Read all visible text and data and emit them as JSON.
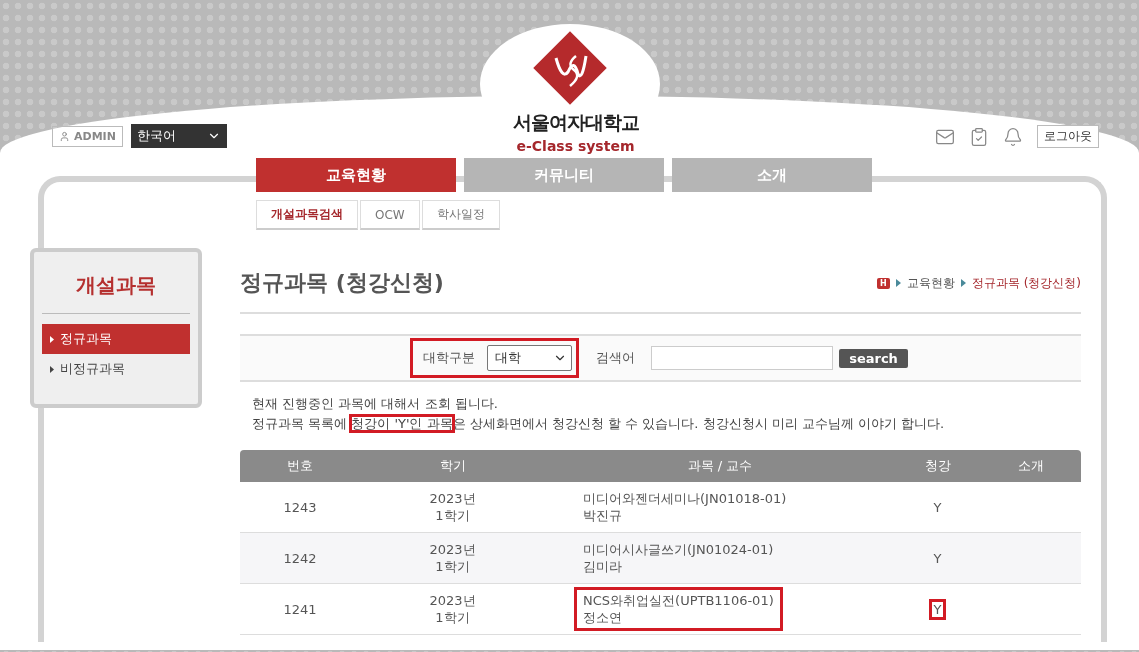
{
  "header": {
    "user": "ADMIN",
    "language": "한국어",
    "school_name": "서울여자대학교",
    "system_name": "e-Class system",
    "logout": "로그아웃"
  },
  "nav_tabs": [
    {
      "label": "교육현황",
      "selected": true
    },
    {
      "label": "커뮤니티",
      "selected": false
    },
    {
      "label": "소개",
      "selected": false
    }
  ],
  "sub_tabs": [
    {
      "label": "개설과목검색",
      "selected": true
    },
    {
      "label": "OCW",
      "selected": false
    },
    {
      "label": "학사일정",
      "selected": false
    }
  ],
  "sidebar": {
    "title": "개설과목",
    "items": [
      {
        "label": "정규과목",
        "selected": true
      },
      {
        "label": "비정규과목",
        "selected": false
      }
    ]
  },
  "page_title": "정규과목 (청강신청)",
  "breadcrumb": {
    "home_label": "H",
    "items": [
      {
        "label": "교육현황",
        "current": false
      },
      {
        "label": "정규과목 (청강신청)",
        "current": true
      }
    ]
  },
  "filter": {
    "category_label": "대학구분",
    "category_value": "대학",
    "highlighted": true,
    "search_label": "검색어",
    "search_button": "search"
  },
  "notice": {
    "line_1": "현재 진행중인 과목에 대해서 조회 됩니다.",
    "line_2": [
      {
        "text": "정규과목 목록에 ",
        "highlighted": false
      },
      {
        "text": "청강이 'Y'인 과목",
        "highlighted": true
      },
      {
        "text": "은 상세화면에서 청강신청 할 수 있습니다. 청강신청시 미리 교수님께 이야기 합니다.",
        "highlighted": false
      }
    ]
  },
  "table": {
    "columns": [
      "번호",
      "학기",
      "과목 / 교수",
      "청강",
      "소개"
    ],
    "rows": [
      {
        "number": "1243",
        "year": "2023년",
        "term": "1학기",
        "course": "미디어와젠더세미나(JN01018-01)",
        "professor": "박진규",
        "audit": "Y",
        "course_highlighted": false,
        "audit_highlighted": false
      },
      {
        "number": "1242",
        "year": "2023년",
        "term": "1학기",
        "course": "미디어시사글쓰기(JN01024-01)",
        "professor": "김미라",
        "audit": "Y",
        "course_highlighted": false,
        "audit_highlighted": false
      },
      {
        "number": "1241",
        "year": "2023년",
        "term": "1학기",
        "course": "NCS와취업실전(UPTB1106-01)",
        "professor": "정소연",
        "audit": "Y",
        "course_highlighted": true,
        "audit_highlighted": true
      }
    ]
  }
}
